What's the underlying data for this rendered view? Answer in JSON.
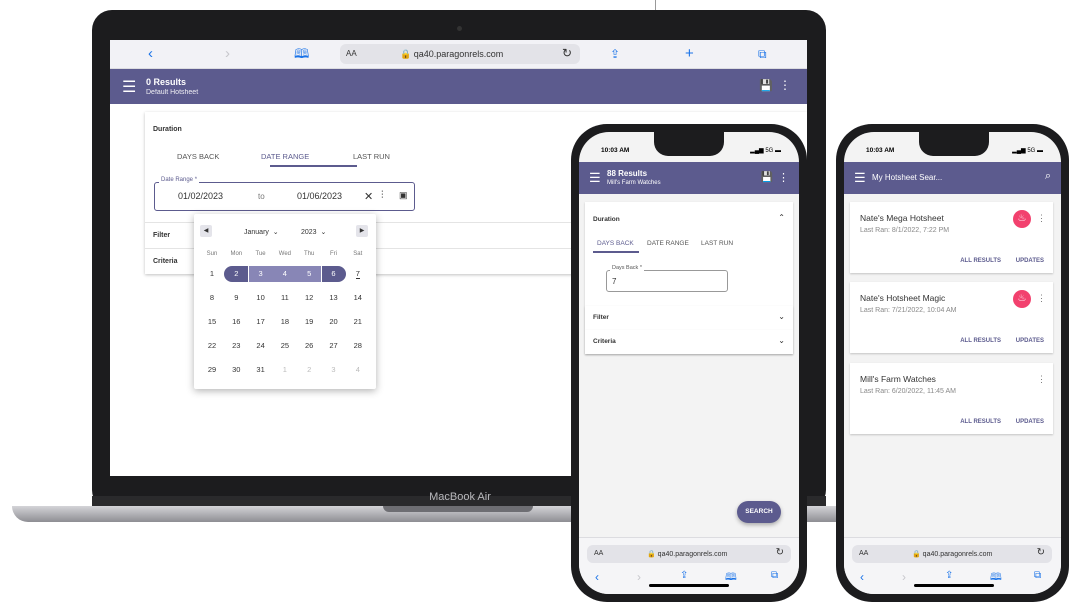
{
  "laptop": {
    "brand": "MacBook Air",
    "browser": {
      "text_size": "AA",
      "url": "qa40.paragonrels.com"
    },
    "header": {
      "title": "0 Results",
      "subtitle": "Default Hotsheet"
    },
    "duration_label": "Duration",
    "tabs": [
      {
        "label": "DAYS BACK"
      },
      {
        "label": "DATE RANGE"
      },
      {
        "label": "LAST RUN"
      }
    ],
    "date_range": {
      "legend": "Date Range *",
      "from": "01/02/2023",
      "to_word": "to",
      "until": "01/06/2023"
    },
    "rows": [
      {
        "label": "Filter"
      },
      {
        "label": "Criteria"
      }
    ],
    "calendar": {
      "month": "January",
      "year": "2023",
      "weekdays": [
        "Sun",
        "Mon",
        "Tue",
        "Wed",
        "Thu",
        "Fri",
        "Sat"
      ],
      "weeks": [
        [
          "1",
          "2",
          "3",
          "4",
          "5",
          "6",
          "7"
        ],
        [
          "8",
          "9",
          "10",
          "11",
          "12",
          "13",
          "14"
        ],
        [
          "15",
          "16",
          "17",
          "18",
          "19",
          "20",
          "21"
        ],
        [
          "22",
          "23",
          "24",
          "25",
          "26",
          "27",
          "28"
        ],
        [
          "29",
          "30",
          "31",
          "1",
          "2",
          "3",
          "4"
        ]
      ]
    }
  },
  "phone1": {
    "time": "10:03 AM",
    "signal": "5G",
    "header": {
      "title": "88 Results",
      "subtitle": "Mill's Farm Watches"
    },
    "duration_label": "Duration",
    "tabs": [
      {
        "label": "DAYS BACK"
      },
      {
        "label": "DATE RANGE"
      },
      {
        "label": "LAST RUN"
      }
    ],
    "days_back": {
      "legend": "Days Back *",
      "value": "7"
    },
    "rows": [
      {
        "label": "Filter"
      },
      {
        "label": "Criteria"
      }
    ],
    "search_button": "SEARCH",
    "browser": {
      "text_size": "AA",
      "url": "qa40.paragonrels.com"
    }
  },
  "phone2": {
    "time": "10:03 AM",
    "signal": "5G",
    "header": {
      "title": "My Hotsheet Sear..."
    },
    "cards": [
      {
        "name": "Nate's Mega Hotsheet",
        "last_ran": "Last Ran: 8/1/2022, 7:22 PM",
        "all_results": "ALL RESULTS",
        "updates": "UPDATES"
      },
      {
        "name": "Nate's Hotsheet Magic",
        "last_ran": "Last Ran: 7/21/2022, 10:04 AM",
        "all_results": "ALL RESULTS",
        "updates": "UPDATES"
      },
      {
        "name": "Mill's Farm Watches",
        "last_ran": "Last Ran: 6/20/2022, 11:45 AM",
        "all_results": "ALL RESULTS",
        "updates": "UPDATES"
      }
    ],
    "browser": {
      "text_size": "AA",
      "url": "qa40.paragonrels.com"
    }
  },
  "colors": {
    "brand": "#5c5b8e",
    "range": "#8886b6",
    "hot": "#f2416e",
    "link": "#1a73e8"
  }
}
